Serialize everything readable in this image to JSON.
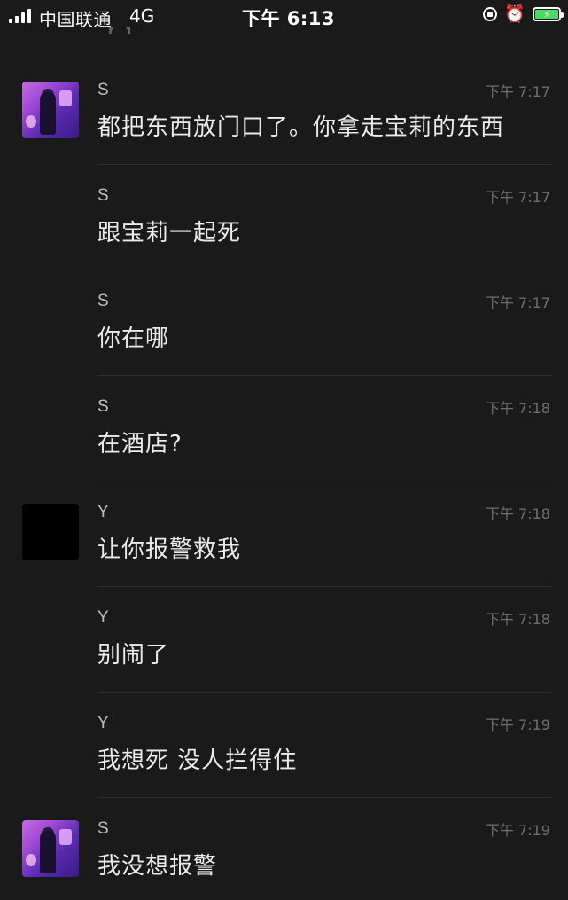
{
  "status_bar": {
    "carrier": "中国联通",
    "network": "4G",
    "time": "下午 6:13",
    "icons": [
      "signal-icon",
      "orientation-lock-icon",
      "alarm-icon",
      "battery-charging-icon"
    ]
  },
  "top_fragment": "【·】",
  "messages": [
    {
      "sender": "S",
      "time": "下午 7:17",
      "text": "都把东西放门口了。你拿走宝莉的东西",
      "avatar": "s"
    },
    {
      "sender": "S",
      "time": "下午 7:17",
      "text": "跟宝莉一起死",
      "avatar": ""
    },
    {
      "sender": "S",
      "time": "下午 7:17",
      "text": "你在哪",
      "avatar": ""
    },
    {
      "sender": "S",
      "time": "下午 7:18",
      "text": "在酒店?",
      "avatar": ""
    },
    {
      "sender": "Y",
      "time": "下午 7:18",
      "text": "让你报警救我",
      "avatar": "y"
    },
    {
      "sender": "Y",
      "time": "下午 7:18",
      "text": "别闹了",
      "avatar": ""
    },
    {
      "sender": "Y",
      "time": "下午 7:19",
      "text": "我想死 没人拦得住",
      "avatar": ""
    },
    {
      "sender": "S",
      "time": "下午 7:19",
      "text": "我没想报警",
      "avatar": "s"
    }
  ],
  "colors": {
    "background": "#1a1a1a",
    "battery": "#4cd964",
    "text": "#ebebeb",
    "timestamp": "#6e6e6e"
  }
}
